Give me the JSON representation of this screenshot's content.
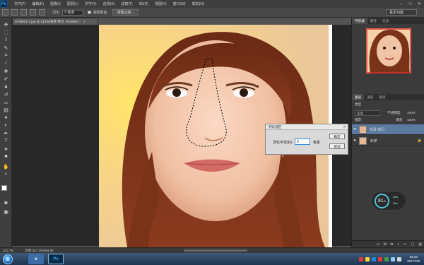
{
  "app": {
    "logo": "Ps"
  },
  "menu": [
    "文件(F)",
    "编辑(E)",
    "图像(I)",
    "图层(L)",
    "文字(Y)",
    "选择(S)",
    "滤镜(T)",
    "3D(D)",
    "视图(V)",
    "窗口(W)",
    "帮助(H)"
  ],
  "window_controls": [
    "–",
    "□",
    "✕"
  ],
  "options": {
    "feather_label": "羽化:",
    "feather_value": "0 像素",
    "antialias_label": "消除锯齿",
    "refine_label": "调整边缘...",
    "workspace_label": "基本功能"
  },
  "document": {
    "tab_title": "0708031-7.jpg @ 212%(背景 拷贝, RGB/8#) *",
    "close": "×"
  },
  "dialog": {
    "title": "羽化选区",
    "close": "✕",
    "radius_label": "羽化半径(R):",
    "radius_value": "2",
    "unit": "像素",
    "ok": "确定",
    "cancel": "取消"
  },
  "navigator": {
    "tabs": [
      "导航器",
      "属性",
      "信息"
    ],
    "active": 0
  },
  "layers": {
    "tabs": [
      "图层",
      "通道",
      "路径"
    ],
    "kind_label": "类型",
    "blend_mode": "正常",
    "opacity_label": "不透明度:",
    "opacity_value": "100%",
    "lock_label": "锁定:",
    "fill_label": "填充:",
    "fill_value": "100%",
    "items": [
      {
        "name": "背景 拷贝",
        "selected": true
      },
      {
        "name": "背景",
        "selected": false
      }
    ]
  },
  "statusbar": {
    "zoom": "211.7%",
    "doc_info": "文档:447.2K/894.5K"
  },
  "gauge": {
    "percent": "81",
    "unit": "%",
    "r1": "0K/s",
    "r2": "0K/s"
  },
  "taskbar": {
    "clock_time": "15:33",
    "clock_date": "2017/1/9"
  },
  "colors": {
    "accent": "#31a8ff",
    "selection_highlight": "#5c7aa0"
  },
  "icons": [
    "move-tool-icon",
    "marquee-tool-icon",
    "lasso-tool-icon",
    "quick-select-icon",
    "crop-tool-icon",
    "eyedropper-icon",
    "healing-icon",
    "brush-icon",
    "stamp-icon",
    "history-brush-icon",
    "eraser-icon",
    "gradient-icon",
    "blur-icon",
    "dodge-icon",
    "pen-icon",
    "type-tool-icon",
    "path-select-icon",
    "shape-tool-icon",
    "hand-tool-icon",
    "zoom-tool-icon"
  ]
}
